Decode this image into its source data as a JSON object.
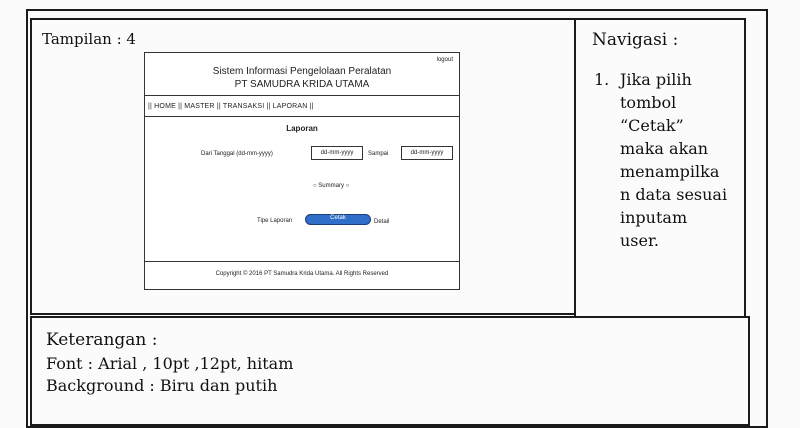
{
  "display": {
    "title": "Tampilan : 4"
  },
  "navigation": {
    "title": "Navigasi :",
    "items": [
      {
        "number": "1.",
        "text": "Jika pilih tombol “Cetak” maka akan menampilka n data sesuai inputam user."
      }
    ]
  },
  "notes": {
    "title": "Keterangan :",
    "font": "Font : Arial , 10pt ,12pt,  hitam",
    "background": "Background : Biru dan putih"
  },
  "mockup": {
    "logout": "logout",
    "system_title": "Sistem Informasi Pengelolaan Peralatan",
    "company": "PT SAMUDRA KRIDA UTAMA",
    "menu": "|| HOME || MASTER || TRANSAKSI || LAPORAN ||",
    "report_title": "Laporan",
    "date_label": "Dari Tanggal (dd-mm-yyyy)",
    "date_from_placeholder": "dd-mm-yyyy",
    "until_label": "Sampai",
    "date_to_placeholder": "dd-mm-yyyy",
    "summary_option": "Summary",
    "type_label": "Tipe Laporan",
    "print_button": "Cetak",
    "detail_label": "Detail",
    "copyright": "Copyright © 2016 PT Samudra Krida Utama. All Rights Reserved"
  }
}
